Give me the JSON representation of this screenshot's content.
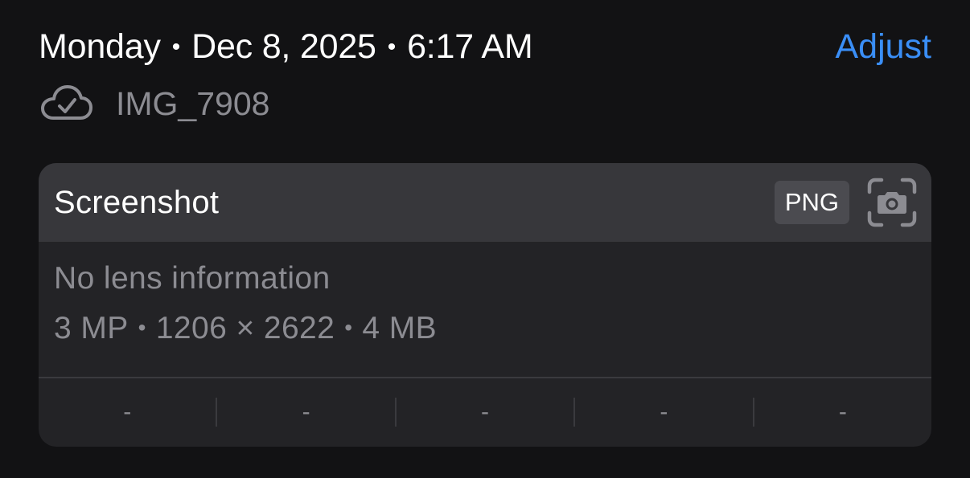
{
  "header": {
    "day": "Monday",
    "date": "Dec 8, 2025",
    "time": "6:17 AM",
    "separator": "•",
    "adjust_label": "Adjust",
    "accent_color": "#3a8ef6"
  },
  "file": {
    "name": "IMG_7908",
    "sync_icon": "cloud-checkmark-icon"
  },
  "card": {
    "title": "Screenshot",
    "format_badge": "PNG",
    "camera_icon": "screenshot-camera-icon",
    "lens_info": "No lens information",
    "megapixels": "3 MP",
    "dimensions": "1206 × 2622",
    "file_size": "4 MB",
    "separator": "•",
    "exif": [
      "-",
      "-",
      "-",
      "-",
      "-"
    ]
  }
}
